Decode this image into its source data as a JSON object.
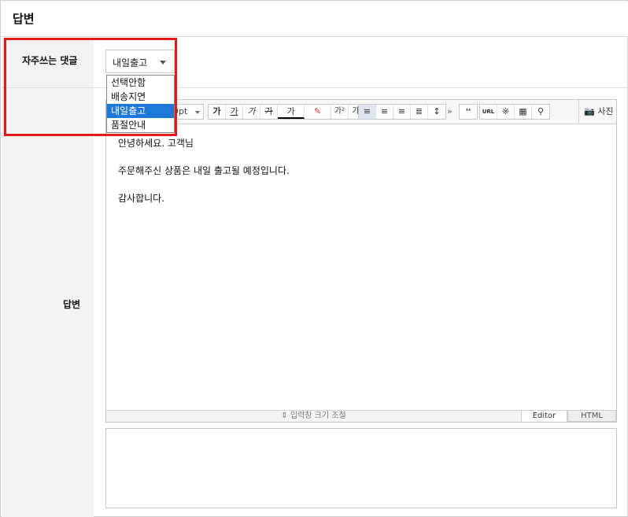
{
  "header": {
    "title": "답변"
  },
  "form": {
    "freq_label": "자주쓰는 댓글",
    "answer_label": "답변"
  },
  "select": {
    "value": "내일출고",
    "options": [
      "선택안함",
      "배송지연",
      "내일출고",
      "품절안내"
    ],
    "selected_index": 2
  },
  "toolbar": {
    "font_size": "9pt",
    "bold": "가",
    "underline": "가",
    "italic": "가",
    "strike": "가",
    "font_color": "가",
    "superscript": "가²",
    "subscript": "가₁",
    "more": "»",
    "quote": "❛❛",
    "url": "URL",
    "special_char": "※",
    "photo": "사진"
  },
  "content": {
    "lines": [
      "안녕하세요.  고객님",
      "주문해주신 상품은 내일 출고될 예정입니다.",
      "감사합니다."
    ]
  },
  "editor": {
    "resize_label": "입력창 크기 조절",
    "resize_icon": "⇕",
    "tab_editor": "Editor",
    "tab_html": "HTML"
  },
  "colors": {
    "highlight": "#e61919",
    "selected_option": "#1e78d7"
  }
}
